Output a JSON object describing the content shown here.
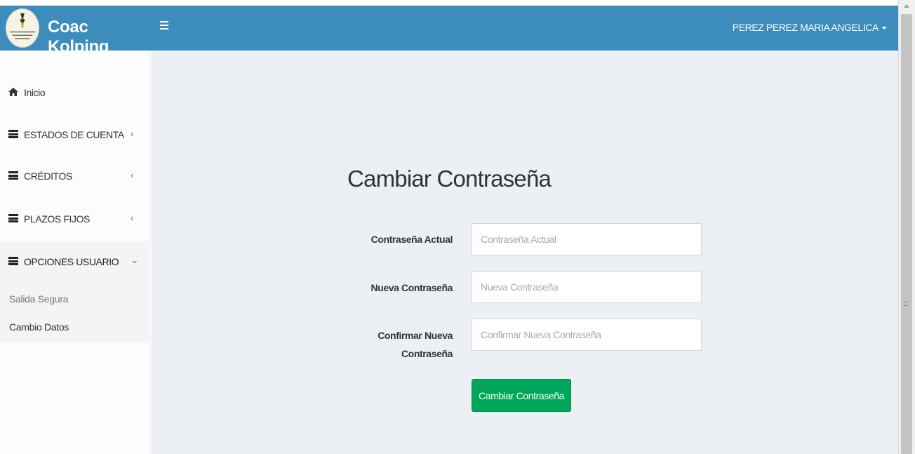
{
  "header": {
    "brand": "Coac Kolping",
    "user_name": "PEREZ PEREZ MARIA ANGELICA",
    "color": "#3c8dbc"
  },
  "sidebar": {
    "items": [
      {
        "label": "Inicio",
        "icon": "home-icon",
        "chevron": ""
      },
      {
        "label": "ESTADOS DE CUENTA",
        "icon": "th-list-icon",
        "chevron": "‹"
      },
      {
        "label": "CRÉDITOS",
        "icon": "th-list-icon",
        "chevron": "‹"
      },
      {
        "label": "PLAZOS FIJOS",
        "icon": "th-list-icon",
        "chevron": "‹"
      },
      {
        "label": "OPCIONES USUARIO",
        "icon": "th-list-icon",
        "chevron": "⌄"
      }
    ],
    "submenu": [
      {
        "label": "Salida Segura",
        "color": "#777777"
      },
      {
        "label": "Cambio Datos",
        "color": "#333333"
      }
    ]
  },
  "form": {
    "title": "Cambiar Contraseña",
    "fields": [
      {
        "label": "Contraseña Actual",
        "placeholder": "Contraseña Actual",
        "value": ""
      },
      {
        "label": "Nueva Contraseña",
        "placeholder": "Nueva Contraseña",
        "value": ""
      },
      {
        "label_line1": "Confirmar Nueva",
        "label_line2": "Contraseña",
        "placeholder": "Confirmar Nueva Contraseña",
        "value": ""
      }
    ],
    "submit_label": "Cambiar Contraseña",
    "submit_color": "#00a65a"
  }
}
